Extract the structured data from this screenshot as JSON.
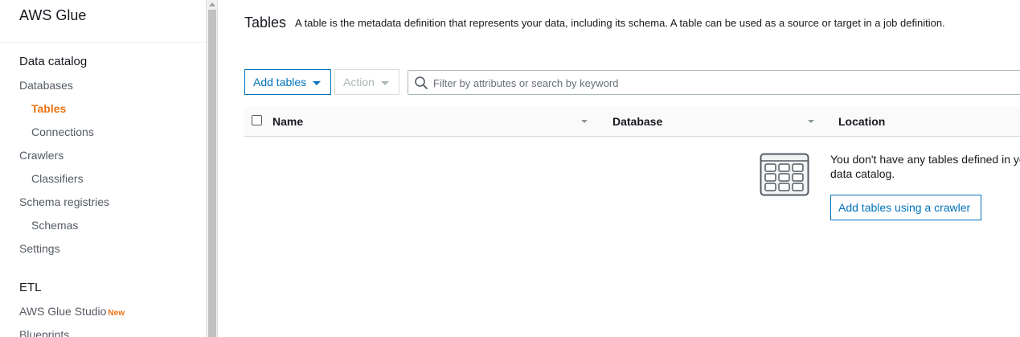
{
  "sidebar": {
    "brand": "AWS Glue",
    "sections": [
      {
        "title": "Data catalog",
        "items": [
          {
            "label": "Databases",
            "level": 1
          },
          {
            "label": "Tables",
            "level": 2,
            "active": true
          },
          {
            "label": "Connections",
            "level": 2
          },
          {
            "label": "Crawlers",
            "level": 1
          },
          {
            "label": "Classifiers",
            "level": 2
          },
          {
            "label": "Schema registries",
            "level": 1
          },
          {
            "label": "Schemas",
            "level": 2
          },
          {
            "label": "Settings",
            "level": 1
          }
        ]
      },
      {
        "title": "ETL",
        "items": [
          {
            "label": "AWS Glue Studio",
            "level": 1,
            "badge": "New"
          },
          {
            "label": "Blueprints",
            "level": 1
          }
        ]
      }
    ]
  },
  "page": {
    "title": "Tables",
    "description": "A table is the metadata definition that represents your data, including its schema. A table can be used as a source or target in a job definition."
  },
  "toolbar": {
    "add_tables_label": "Add tables",
    "action_label": "Action",
    "search_placeholder": "Filter by attributes or search by keyword"
  },
  "table": {
    "columns": [
      "Name",
      "Database",
      "Location"
    ]
  },
  "empty_state": {
    "line1": "You don't have any tables defined in your",
    "line2": "data catalog.",
    "button_label": "Add tables using a crawler"
  },
  "colors": {
    "accent": "#ec7211",
    "link": "#0073bb"
  },
  "icons": {
    "search": "search-icon",
    "table_grid": "table-grid-icon",
    "caret": "caret-down-icon",
    "checkbox": "checkbox"
  }
}
